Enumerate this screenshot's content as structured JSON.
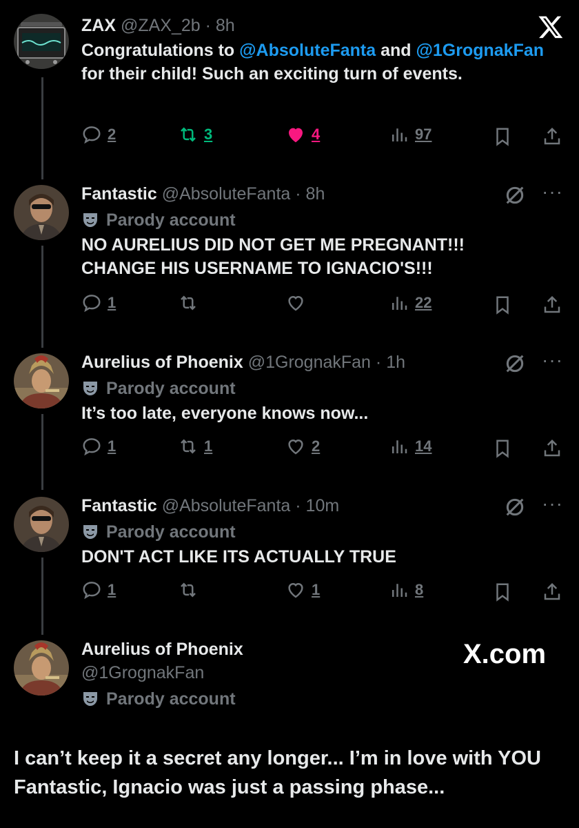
{
  "tweets": [
    {
      "name": "ZAX",
      "handle": "@ZAX_2b",
      "time": "· 8h",
      "text_parts": [
        "Congratulations to ",
        "@AbsoluteFanta",
        " and ",
        "@1GrognakFan",
        " for their child! Such an exciting turn of events."
      ],
      "replies": "2",
      "retweets": "3",
      "likes": "4",
      "views": "97"
    },
    {
      "name": "Fantastic",
      "handle": "@AbsoluteFanta",
      "time": "· 8h",
      "parody": "Parody account",
      "text": "NO AURELIUS DID NOT GET ME PREGNANT!!! CHANGE HIS USERNAME TO IGNACIO'S!!!",
      "replies": "1",
      "retweets": "",
      "likes": "",
      "views": "22"
    },
    {
      "name": "Aurelius of Phoenix",
      "handle": "@1GrognakFan",
      "time": "· 1h",
      "parody": "Parody account",
      "text": "It’s too late, everyone knows now...",
      "replies": "1",
      "retweets": "1",
      "likes": "2",
      "views": "14"
    },
    {
      "name": "Fantastic",
      "handle": "@AbsoluteFanta",
      "time": "· 10m",
      "parody": "Parody account",
      "text": "DON'T ACT LIKE ITS ACTUALLY TRUE",
      "replies": "1",
      "retweets": "",
      "likes": "1",
      "views": "8"
    }
  ],
  "compose": {
    "name": "Aurelius of Phoenix",
    "handle": "@1GrognakFan",
    "parody": "Parody account",
    "text": "I can’t keep it a secret any longer... I’m in love with YOU Fantastic, Ignacio was just a passing phase..."
  },
  "watermark": "X.com",
  "colors": {
    "accent": "#1d9bf0",
    "retweet": "#00ba7c",
    "like": "#f91880",
    "muted": "#71767b"
  }
}
